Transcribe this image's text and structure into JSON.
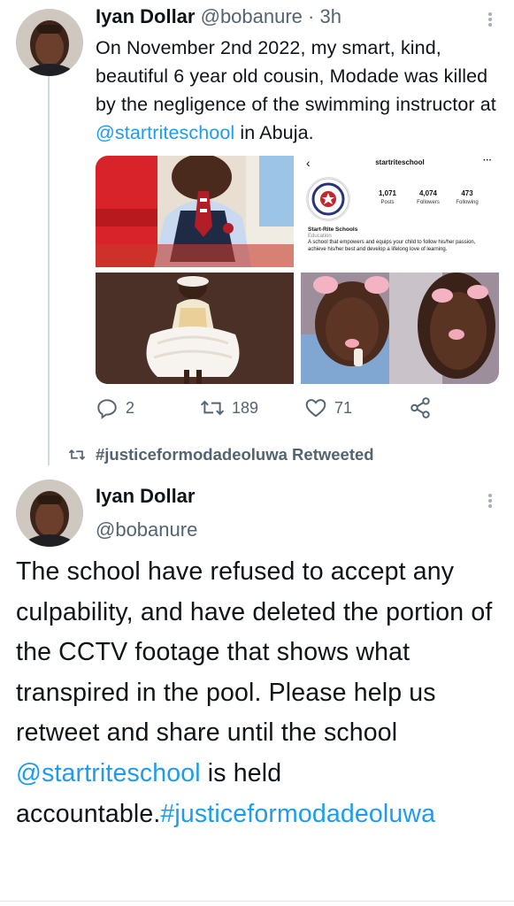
{
  "tweet1": {
    "display_name": "Iyan Dollar",
    "handle": "@bobanure",
    "separator": "·",
    "time": "3h",
    "text_before": "On November 2nd 2022, my smart, kind, beautiful  6 year old cousin, Modade was killed by the negligence of the swimming instructor at ",
    "mention": "@startriteschool",
    "text_after": " in Abuja.",
    "media": {
      "instagram": {
        "username": "startriteschool",
        "posts_count": "1,071",
        "posts_label": "Posts",
        "followers_count": "4,074",
        "followers_label": "Followers",
        "following_count": "473",
        "following_label": "Following",
        "business_name": "Start-Rite Schools",
        "category": "Education",
        "bio": "A school that empowers and equips your child to follow his/her passion, achieve his/her best and develop a lifelong love of learning.",
        "back_glyph": "‹",
        "more_glyph": "···"
      }
    },
    "actions": {
      "replies": "2",
      "retweets": "189",
      "likes": "71"
    }
  },
  "retweet_banner": {
    "label": "#justiceformodadeoluwa Retweeted"
  },
  "tweet2": {
    "display_name": "Iyan Dollar",
    "handle": "@bobanure",
    "text_part1": "The school have refused to accept any culpability, and have deleted the portion of the CCTV footage that shows what transpired in the pool. Please help us retweet and share until the school ",
    "mention": "@startriteschool",
    "text_part2": " is held accountable.",
    "hashtag": "#justiceformodadeoluwa"
  },
  "icons": {
    "reply": "reply-icon",
    "retweet": "retweet-icon",
    "like": "heart-icon",
    "share": "share-icon",
    "more": "more-vertical-icon"
  },
  "colors": {
    "accent": "#1d9bf0",
    "muted": "#536471",
    "text": "#0f1419"
  }
}
